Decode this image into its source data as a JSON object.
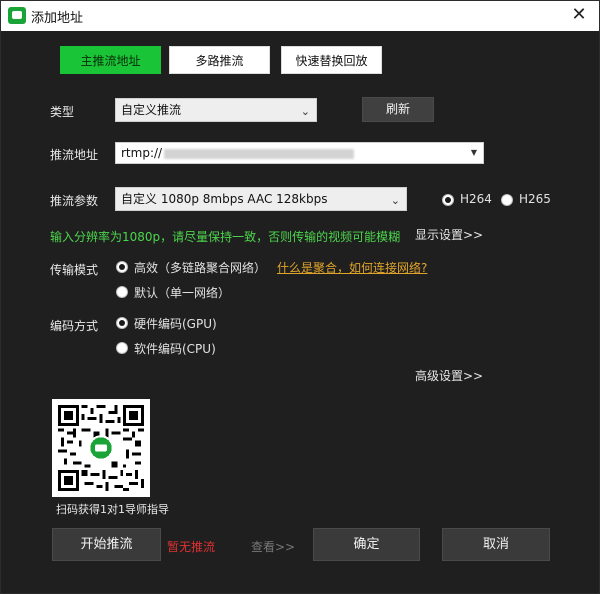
{
  "window": {
    "title": "添加地址",
    "close_glyph": "✕"
  },
  "tabs": [
    {
      "label": "主推流地址",
      "active": true
    },
    {
      "label": "多路推流",
      "active": false
    },
    {
      "label": "快速替换回放",
      "active": false
    }
  ],
  "type_row": {
    "label": "类型",
    "selected": "自定义推流",
    "refresh_label": "刷新"
  },
  "url_row": {
    "label": "推流地址",
    "value_prefix": "rtmp://"
  },
  "params_row": {
    "label": "推流参数",
    "selected": "自定义 1080p 8mbps AAC 128kbps",
    "codec_options": [
      "H264",
      "H265"
    ],
    "codec_selected": "H264"
  },
  "hint": {
    "text": "输入分辨率为1080p，请尽量保持一致，否则传输的视频可能模糊",
    "display_settings": "显示设置>>"
  },
  "transport": {
    "label": "传输模式",
    "options": [
      "高效（多链路聚合网络）",
      "默认（单一网络）"
    ],
    "selected": "高效（多链路聚合网络）",
    "help_link": "什么是聚合，如何连接网络?"
  },
  "encoding": {
    "label": "编码方式",
    "options": [
      "硬件编码(GPU)",
      "软件编码(CPU)"
    ],
    "selected": "硬件编码(GPU)"
  },
  "advanced_settings": "高级设置>>",
  "qr": {
    "caption": "扫码获得1对1导师指导"
  },
  "footer": {
    "start_label": "开始推流",
    "status_text": "暂无推流",
    "view_label": "查看>>",
    "ok_label": "确定",
    "cancel_label": "取消"
  },
  "colors": {
    "accent": "#19c536",
    "warning": "#e0a42a",
    "error": "#e03030",
    "hint": "#4cd64c"
  },
  "icons": {
    "app": "app-logo-icon",
    "close": "close-icon",
    "dropdown": "chevron-down-icon",
    "qr": "qr-code-icon"
  }
}
